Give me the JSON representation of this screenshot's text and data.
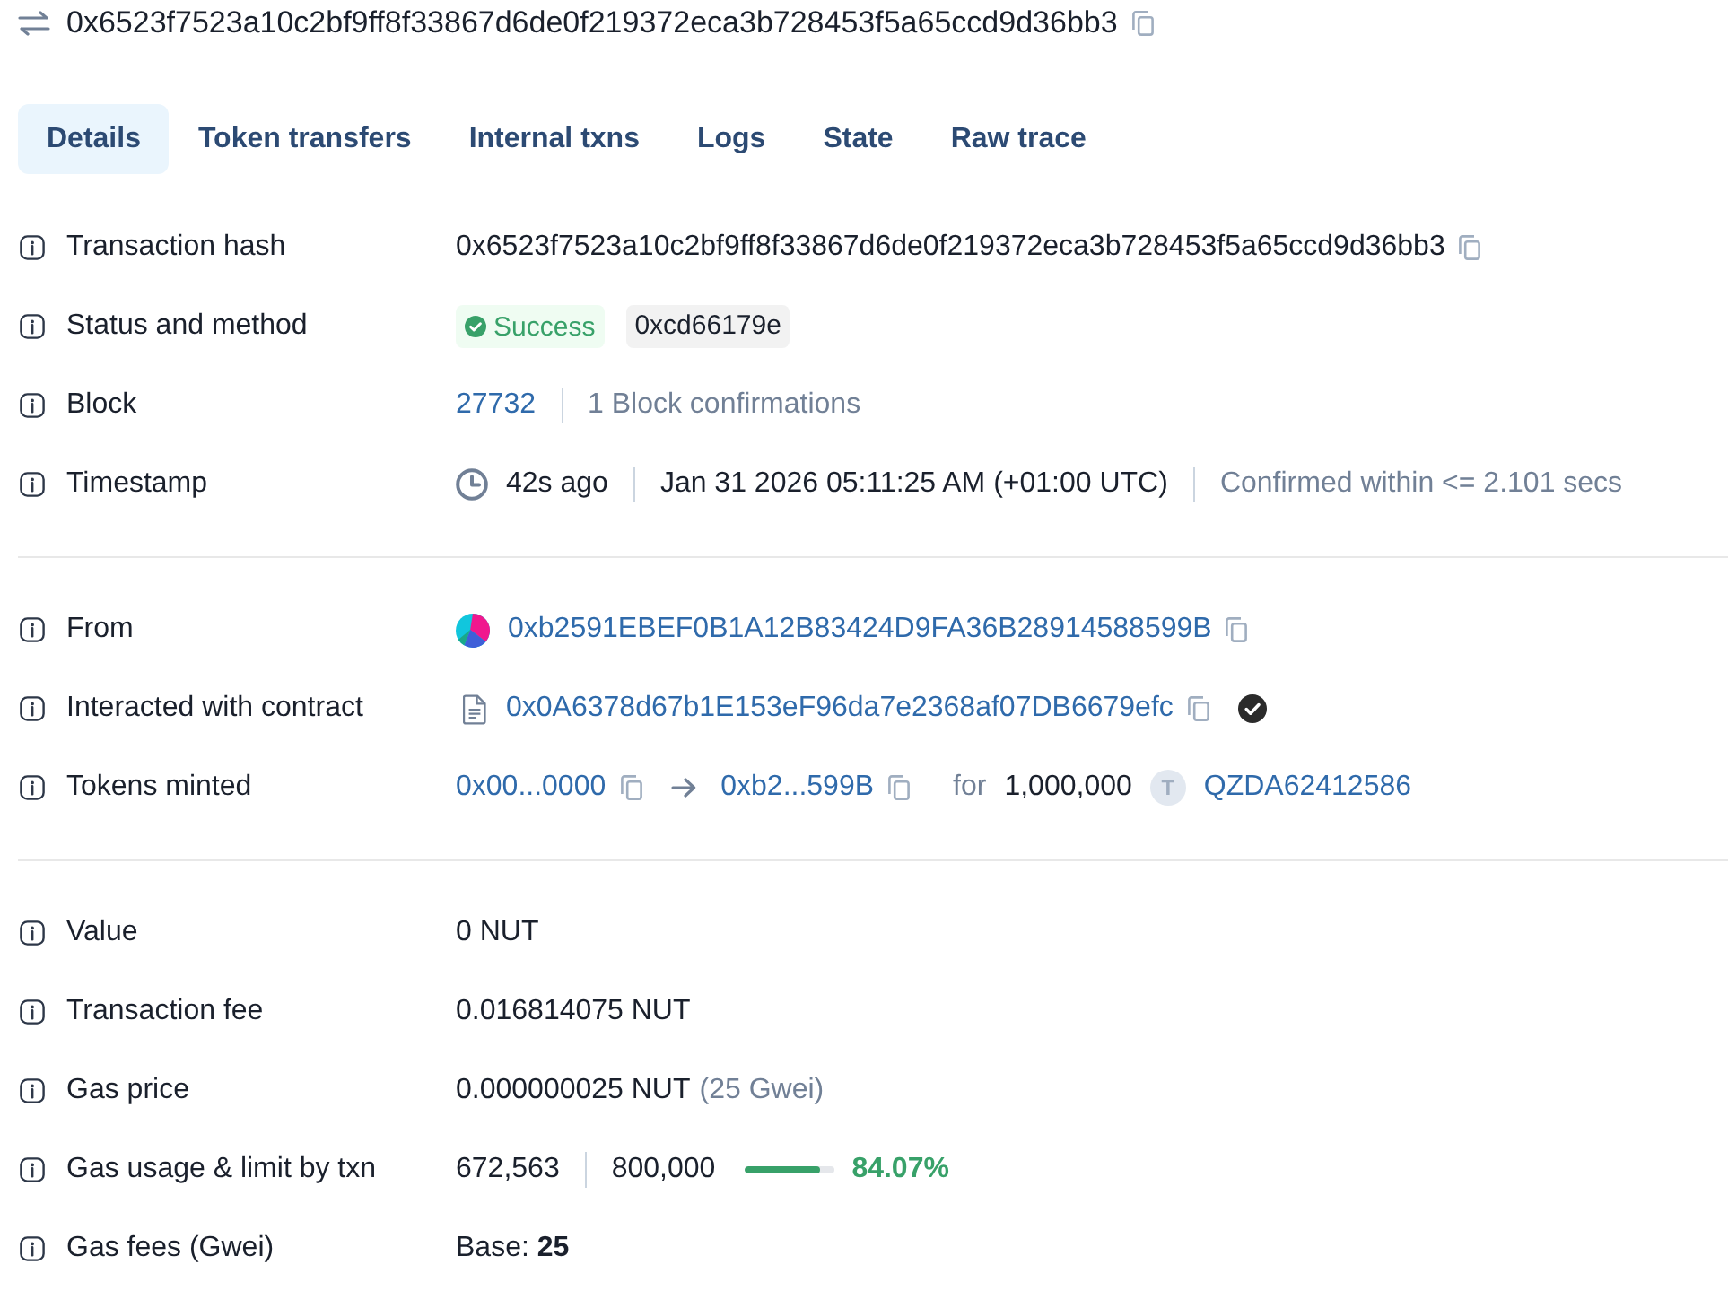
{
  "header": {
    "hash": "0x6523f7523a10c2bf9ff8f33867d6de0f219372eca3b728453f5a65ccd9d36bb3"
  },
  "tabs": [
    {
      "label": "Details",
      "selected": true
    },
    {
      "label": "Token transfers",
      "selected": false
    },
    {
      "label": "Internal txns",
      "selected": false
    },
    {
      "label": "Logs",
      "selected": false
    },
    {
      "label": "State",
      "selected": false
    },
    {
      "label": "Raw trace",
      "selected": false
    }
  ],
  "sections": [
    {
      "rows": [
        {
          "kind": "hash",
          "label": "Transaction hash",
          "value": "0x6523f7523a10c2bf9ff8f33867d6de0f219372eca3b728453f5a65ccd9d36bb3"
        },
        {
          "kind": "status",
          "label": "Status and method",
          "status": "Success",
          "method": "0xcd66179e"
        },
        {
          "kind": "block",
          "label": "Block",
          "block": "27732",
          "confirmations": "1 Block confirmations"
        },
        {
          "kind": "timestamp",
          "label": "Timestamp",
          "age": "42s ago",
          "date": "Jan 31 2026 05:11:25 AM (+01:00 UTC)",
          "confirmed": "Confirmed within <= 2.101 secs"
        }
      ]
    },
    {
      "rows": [
        {
          "kind": "address",
          "label": "From",
          "address": "0xb2591EBEF0B1A12B83424D9FA36B28914588599B"
        },
        {
          "kind": "contract",
          "label": "Interacted with contract",
          "address": "0x0A6378d67b1E153eF96da7e2368af07DB6679efc",
          "verified": true
        },
        {
          "kind": "transfer",
          "label": "Tokens minted",
          "from": "0x00...0000",
          "to": "0xb2...599B",
          "for": "for",
          "amount": "1,000,000",
          "token_letter": "T",
          "token": "QZDA62412586"
        }
      ]
    },
    {
      "rows": [
        {
          "kind": "amount",
          "label": "Value",
          "value": "0 NUT"
        },
        {
          "kind": "amount",
          "label": "Transaction fee",
          "value": "0.016814075 NUT"
        },
        {
          "kind": "amount",
          "label": "Gas price",
          "value": "0.000000025 NUT",
          "note": "(25 Gwei)"
        },
        {
          "kind": "gas",
          "label": "Gas usage & limit by txn",
          "used": "672,563",
          "limit": "800,000",
          "level": 0.8407,
          "percent": "84.07%"
        },
        {
          "kind": "amount",
          "label": "Gas fees (Gwei)",
          "value": "Base: **25**"
        }
      ]
    }
  ]
}
